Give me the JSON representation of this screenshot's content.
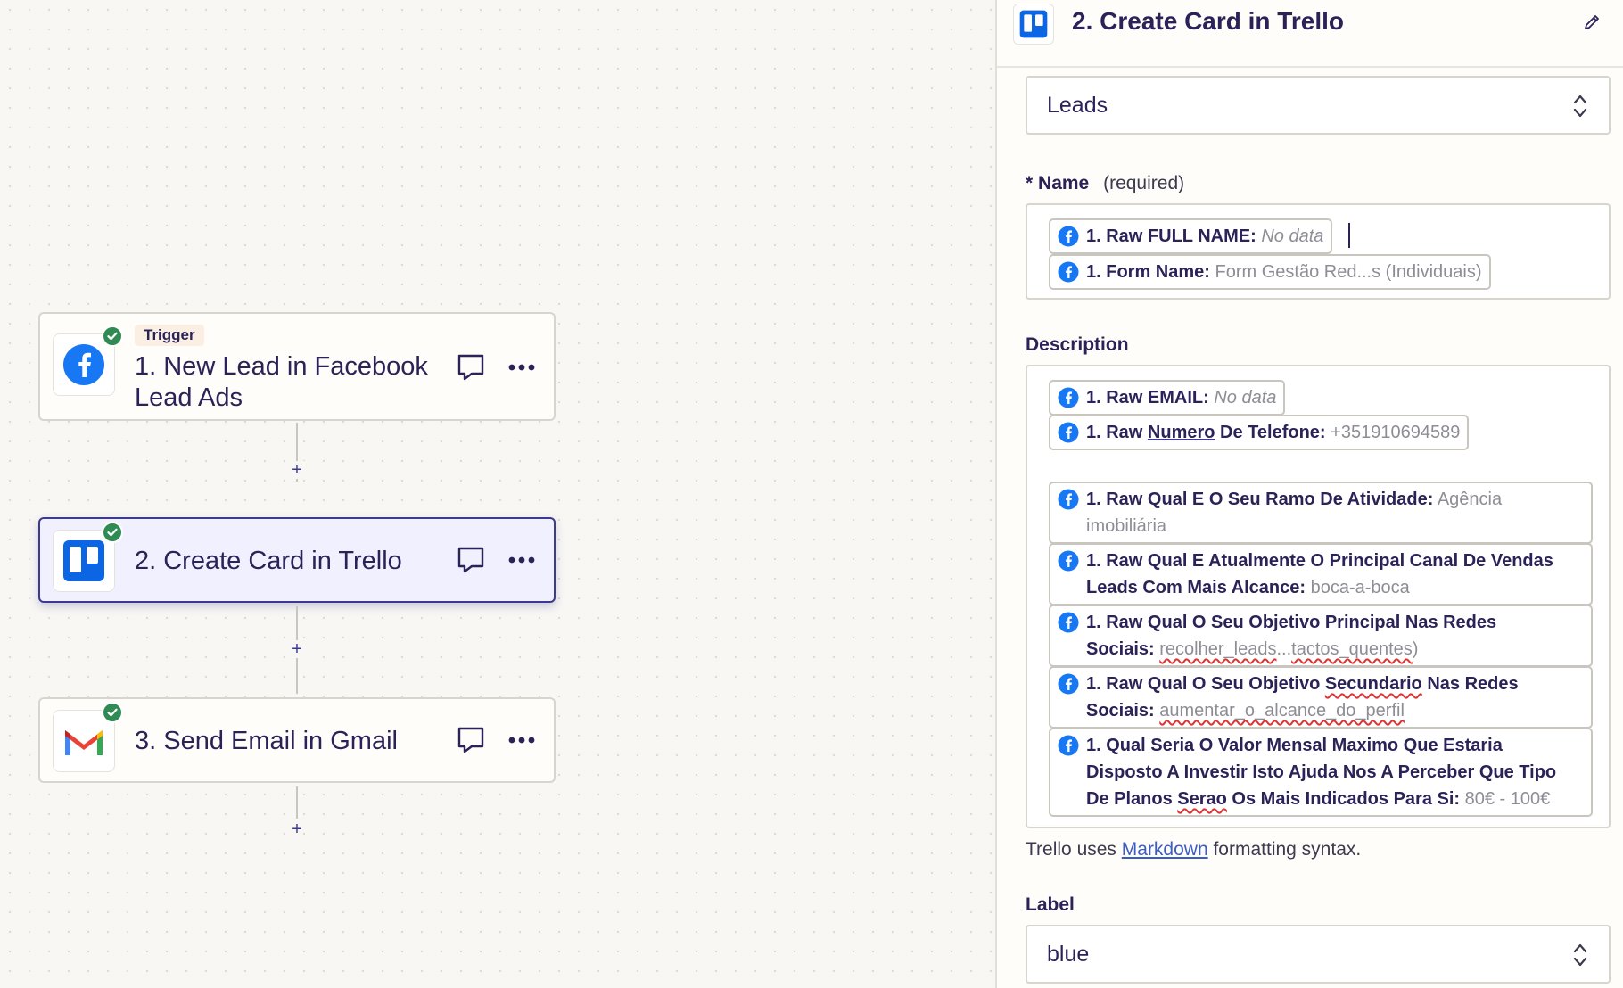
{
  "canvas": {
    "steps": [
      {
        "badge": "Trigger",
        "title_line1": "1. New Lead in Facebook",
        "title_line2": "Lead Ads",
        "icon": "facebook-icon"
      },
      {
        "title": "2. Create Card in Trello",
        "icon": "trello-icon"
      },
      {
        "title": "3. Send Email in Gmail",
        "icon": "gmail-icon"
      }
    ],
    "add_step_symbol": "+"
  },
  "panel": {
    "title": "2. Create Card in Trello",
    "list_select": {
      "value": "Leads"
    },
    "name_field": {
      "label": "Name",
      "required_marker": "*",
      "required_text": "(required)",
      "pills": [
        {
          "key": "1. Raw FULL NAME:",
          "value": "No data"
        },
        {
          "key": "1. Form Name:",
          "value": "Form Gestão Red...s (Individuais)"
        }
      ]
    },
    "description_field": {
      "label": "Description",
      "pills": [
        {
          "key": "1. Raw EMAIL:",
          "value": "No data"
        },
        {
          "key_a": "1. Raw ",
          "key_b": "Numero",
          "key_c": " De Telefone:",
          "value": "+351910694589"
        },
        {
          "key": "1. Raw Qual E O Seu Ramo De Atividade:",
          "value": "Agência imobiliária"
        },
        {
          "key_line1": "1. Raw Qual E Atualmente O Principal Canal De Vendas",
          "key_line2": "Leads Com Mais Alcance:",
          "value": "boca-a-boca"
        },
        {
          "key_line1": "1. Raw Qual O Seu Objetivo Principal Nas Redes",
          "key_line2": "Sociais:",
          "value_a": "recolher_leads",
          "value_b": "...",
          "value_c": "tactos_quentes",
          "value_d": ")"
        },
        {
          "key_line1a": "1. Raw Qual O Seu Objetivo ",
          "key_line1b": "Secundario",
          "key_line1c": " Nas Redes",
          "key_line2": "Sociais:",
          "value": "aumentar_o_alcance_do_perfil"
        },
        {
          "key_line1": "1. Qual Seria O Valor Mensal Maximo Que Estaria",
          "key_line2": "Disposto A Investir Isto Ajuda Nos A Perceber Que Tipo",
          "key_line3a": "De Planos ",
          "key_line3b": "Serao",
          "key_line3c": " Os Mais Indicados Para Si:",
          "value": "80€ - 100€"
        }
      ]
    },
    "helper": {
      "before": "Trello uses ",
      "link": "Markdown",
      "after": " formatting syntax."
    },
    "label_field": {
      "label": "Label",
      "value": "blue"
    }
  },
  "colors": {
    "accent": "#3b3a8f",
    "facebook": "#1877f2",
    "trello": "#0c66e4",
    "check": "#2f8a53"
  }
}
